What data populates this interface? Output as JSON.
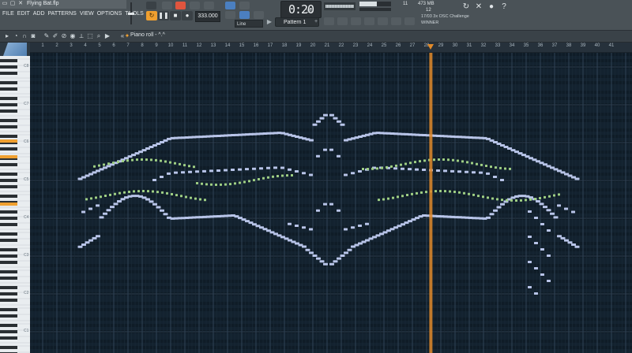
{
  "window": {
    "song_title": "Flying Bat.flp"
  },
  "menu": [
    "FILE",
    "EDIT",
    "ADD",
    "PATTERNS",
    "VIEW",
    "OPTIONS",
    "TOOLS",
    "?"
  ],
  "transport": {
    "tempo": "333.000",
    "time": "0:20",
    "time_ms": "33",
    "snap": "Line",
    "pattern": "Pattern 1"
  },
  "monitor": {
    "memory": "473 MB",
    "mem_left": "11",
    "polyphony": "12",
    "cpu_fraction": 0.55
  },
  "news": {
    "line1": "17/03  3x OSC Challenge",
    "line2": "WINNER"
  },
  "piano_roll": {
    "title": "Piano roll - ^.^"
  },
  "ruler": {
    "bars": [
      1,
      2,
      3,
      4,
      5,
      6,
      7,
      8,
      9,
      10,
      11,
      12,
      13,
      14,
      15,
      16,
      17,
      18,
      19,
      20,
      21,
      22,
      23,
      24,
      25,
      26,
      27,
      28,
      29,
      30,
      31,
      32,
      33,
      34,
      35,
      36,
      37,
      38,
      39,
      40,
      41
    ]
  },
  "keyboard": {
    "octaves": [
      "C8",
      "C7",
      "C6",
      "C5",
      "C4",
      "C3",
      "C2",
      "C1"
    ]
  },
  "playhead": {
    "bar": 28.3
  },
  "colors": {
    "note_primary": "#b8c4e8",
    "note_ghost": "#9fcf84",
    "playhead": "#e08a2a",
    "grid_bg": "#13222f"
  }
}
